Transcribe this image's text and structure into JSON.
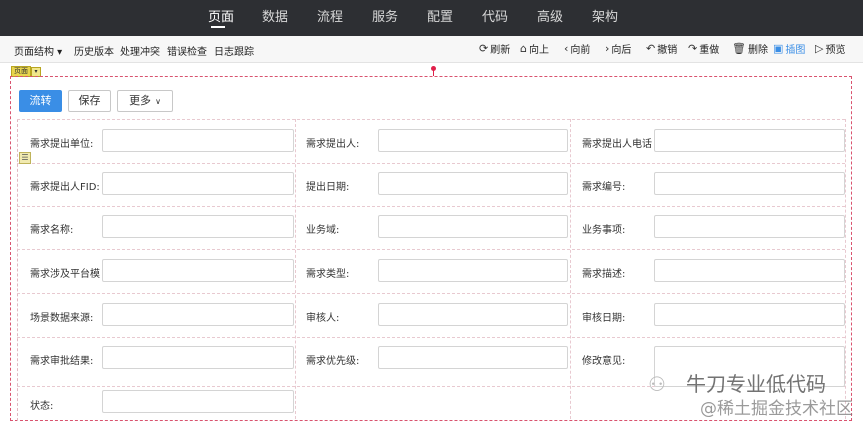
{
  "top_nav": {
    "items": [
      "页面",
      "数据",
      "流程",
      "服务",
      "配置",
      "代码",
      "高级",
      "架构"
    ],
    "active": "页面"
  },
  "toolbar": {
    "left": [
      "页面结构 ▾",
      "历史版本",
      "处理冲突",
      "错误检查",
      "日志跟踪"
    ],
    "right": [
      {
        "icon": "refresh-icon",
        "glyph": "⟳",
        "label": "刷新"
      },
      {
        "icon": "up-icon",
        "glyph": "⌂",
        "label": "向上"
      },
      {
        "icon": "chevron-left-icon",
        "glyph": "‹",
        "label": "向前"
      },
      {
        "icon": "chevron-right-icon",
        "glyph": "›",
        "label": "向后"
      },
      {
        "icon": "undo-icon",
        "glyph": "↶",
        "label": "撤销"
      },
      {
        "icon": "redo-icon",
        "glyph": "↷",
        "label": "重做"
      },
      {
        "icon": "trash-icon",
        "glyph": "🗑",
        "label": "删除"
      },
      {
        "icon": "image-icon",
        "glyph": "▣",
        "label": "插图"
      },
      {
        "icon": "preview-icon",
        "glyph": "▷",
        "label": "预览"
      }
    ]
  },
  "design": {
    "page_tag": "页面",
    "actions": {
      "submit": "流转",
      "save": "保存",
      "more": "更多"
    }
  },
  "form": {
    "fields": [
      [
        "需求提出单位:",
        "需求提出人:",
        "需求提出人电话"
      ],
      [
        "需求提出人FID:",
        "提出日期:",
        "需求编号:"
      ],
      [
        "需求名称:",
        "业务域:",
        "业务事项:"
      ],
      [
        "需求涉及平台模",
        "需求类型:",
        "需求描述:"
      ],
      [
        "场景数据来源:",
        "审核人:",
        "审核日期:"
      ],
      [
        "需求审批结果:",
        "需求优先级:",
        "修改意见:"
      ],
      [
        "状态:"
      ]
    ]
  },
  "watermark": {
    "line1": "牛刀专业低代码",
    "line2": "@稀土掘金技术社区"
  },
  "colors": {
    "nav_bg": "#2d2f33",
    "primary": "#3a8ee6",
    "frame_dash": "#d9536f"
  }
}
